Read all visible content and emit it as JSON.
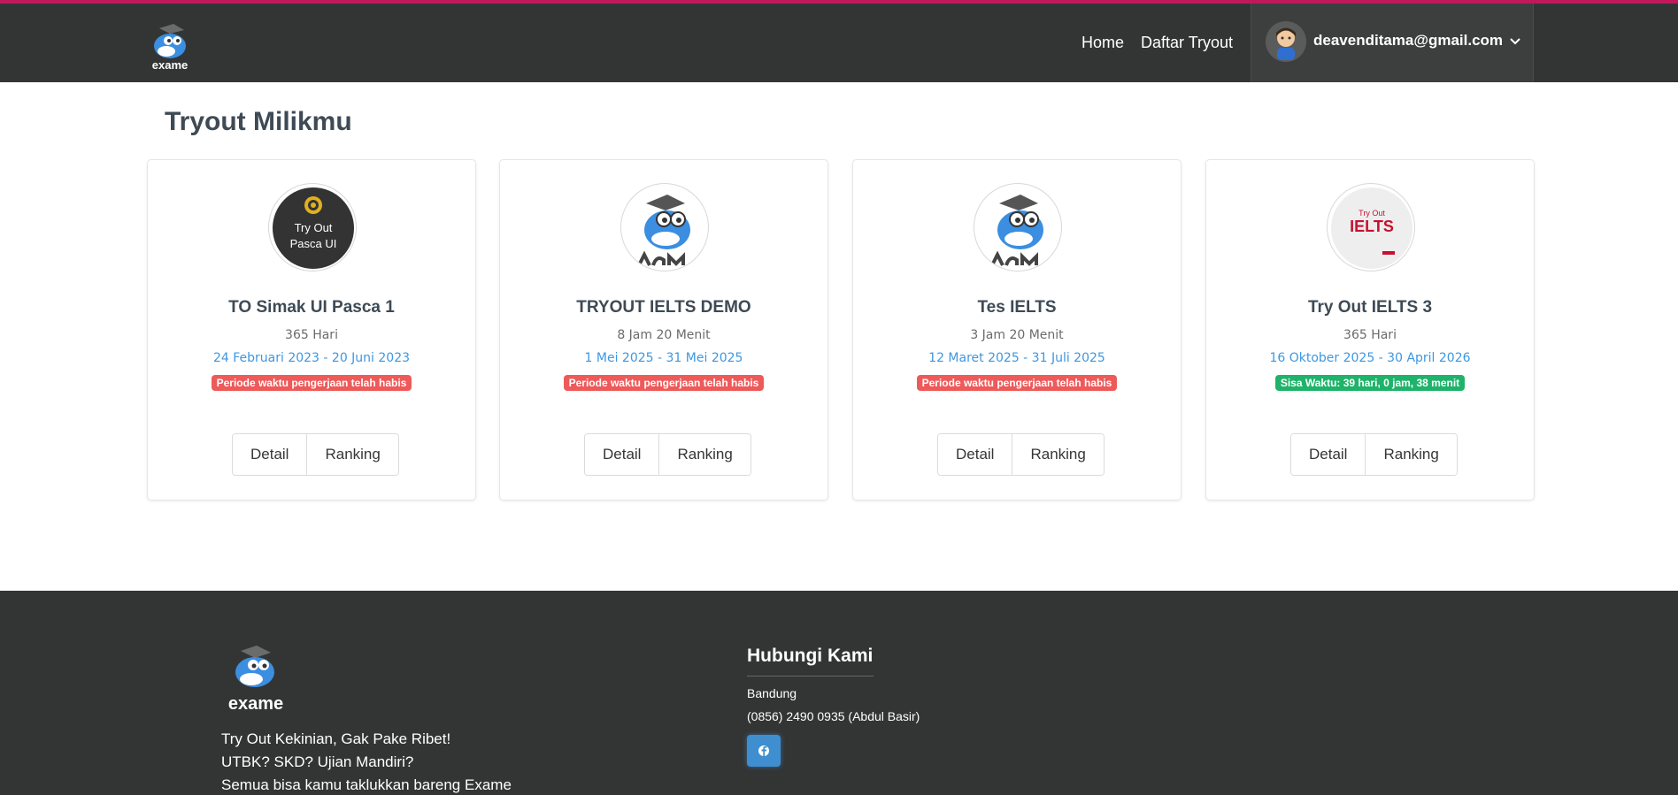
{
  "navbar": {
    "home": "Home",
    "daftar": "Daftar Tryout",
    "user_email": "deavenditama@gmail.com"
  },
  "page": {
    "title": "Tryout Milikmu"
  },
  "cards": [
    {
      "logo_line1": "Try Out",
      "logo_line2": "Pasca UI",
      "title": "TO Simak UI Pasca 1",
      "duration": "365 Hari",
      "period": "24 Februari 2023 - 20 Juni 2023",
      "badge": "Periode waktu pengerjaan telah habis",
      "badge_color": "#ee5a5a",
      "detail": "Detail",
      "ranking": "Ranking"
    },
    {
      "title": "TRYOUT IELTS DEMO",
      "duration": "8 Jam 20 Menit",
      "period": "1 Mei 2025 - 31 Mei 2025",
      "badge": "Periode waktu pengerjaan telah habis",
      "badge_color": "#ee5a5a",
      "detail": "Detail",
      "ranking": "Ranking"
    },
    {
      "title": "Tes IELTS",
      "duration": "3 Jam 20 Menit",
      "period": "12 Maret 2025 - 31 Juli 2025",
      "badge": "Periode waktu pengerjaan telah habis",
      "badge_color": "#ee5a5a",
      "detail": "Detail",
      "ranking": "Ranking"
    },
    {
      "logo_line1": "Try Out",
      "logo_line2": "IELTS",
      "title": "Try Out IELTS 3",
      "duration": "365 Hari",
      "period": "16 Oktober 2025 - 30 April 2026",
      "badge": "Sisa Waktu: 39 hari, 0 jam, 38 menit",
      "badge_color": "#1fb36a",
      "detail": "Detail",
      "ranking": "Ranking"
    }
  ],
  "footer": {
    "brand": "exame",
    "tagline1": "Try Out Kekinian, Gak Pake Ribet!",
    "tagline2": "UTBK? SKD? Ujian Mandiri?",
    "tagline3": "Semua bisa kamu taklukkan bareng Exame",
    "contact_title": "Hubungi Kami",
    "city": "Bandung",
    "phone": "(0856) 2490 0935 (Abdul Basir)",
    "facebook_icon": "facebook-icon"
  },
  "colors": {
    "navbar_bg": "#333535",
    "accent_top": "#c2185b",
    "link_blue": "#3e97e0",
    "danger": "#ee5a5a",
    "success": "#1fb36a"
  }
}
